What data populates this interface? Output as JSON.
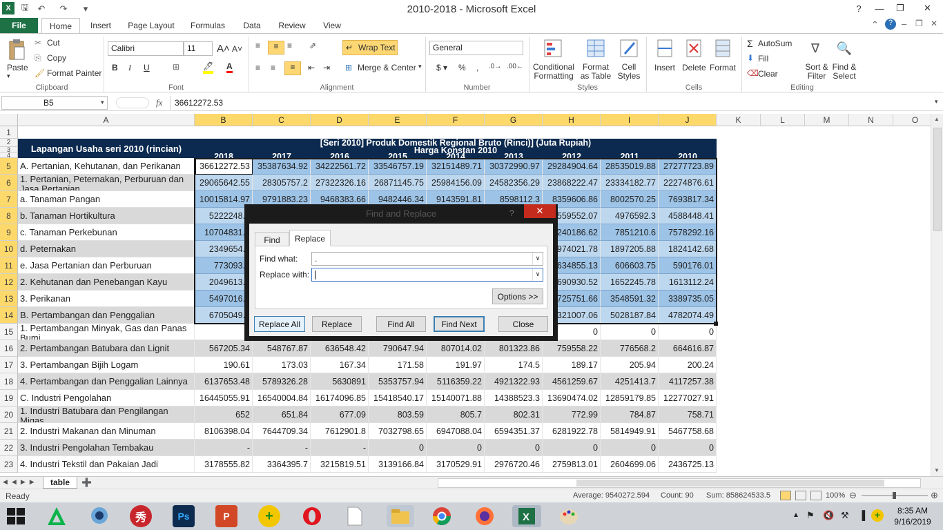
{
  "window": {
    "title": "2010-2018  -  Microsoft Excel"
  },
  "tabs": [
    "File",
    "Home",
    "Insert",
    "Page Layout",
    "Formulas",
    "Data",
    "Review",
    "View"
  ],
  "clipboard": {
    "paste": "Paste",
    "cut": "Cut",
    "copy": "Copy",
    "format_painter": "Format Painter",
    "group": "Clipboard"
  },
  "font": {
    "name": "Calibri",
    "size": "11",
    "group": "Font"
  },
  "alignment": {
    "wrap": "Wrap Text",
    "merge": "Merge & Center",
    "group": "Alignment"
  },
  "number": {
    "format": "General",
    "group": "Number"
  },
  "styles": {
    "conditional": "Conditional Formatting",
    "format_table": "Format as Table",
    "cell_styles": "Cell Styles",
    "group": "Styles"
  },
  "cells": {
    "insert": "Insert",
    "delete": "Delete",
    "format": "Format",
    "group": "Cells"
  },
  "editing": {
    "autosum": "AutoSum",
    "fill": "Fill",
    "clear": "Clear",
    "sort": "Sort & Filter",
    "find": "Find & Select",
    "group": "Editing"
  },
  "formula_bar": {
    "name_box": "B5",
    "fx": "fx",
    "value": "36612272.53"
  },
  "columns": [
    "A",
    "B",
    "C",
    "D",
    "E",
    "F",
    "G",
    "H",
    "I",
    "J",
    "K",
    "L",
    "M",
    "N",
    "O"
  ],
  "header": {
    "label": "Lapangan Usaha seri 2010 (rincian)",
    "title1": "[Seri 2010] Produk Domestik Regional Bruto (Rinci)] (Juta Rupiah)",
    "title2": "Harga Konstan 2010",
    "years": [
      "2018",
      "2017",
      "2016",
      "2015",
      "2014",
      "2013",
      "2012",
      "2011",
      "2010"
    ]
  },
  "rows": [
    {
      "n": "5",
      "label": "A. Pertanian, Kehutanan, dan Perikanan",
      "v": [
        "36612272.53",
        "35387634.92",
        "34222561.72",
        "33546757.19",
        "32151489.71",
        "30372990.97",
        "29284904.64",
        "28535019.88",
        "27277723.89"
      ]
    },
    {
      "n": "6",
      "label": "1. Pertanian, Peternakan, Perburuan dan Jasa Pertanian",
      "v": [
        "29065642.55",
        "28305757.2",
        "27322326.16",
        "26871145.75",
        "25984156.09",
        "24582356.29",
        "23868222.47",
        "23334182.77",
        "22274876.61"
      ]
    },
    {
      "n": "7",
      "label": "a. Tanaman Pangan",
      "v": [
        "10015814.97",
        "9791883.23",
        "9468383.66",
        "9482446.34",
        "9143591.81",
        "8598112.3",
        "8359606.86",
        "8002570.25",
        "7693817.34"
      ]
    },
    {
      "n": "8",
      "label": "b. Tanaman Hortikultura",
      "v": [
        "5222248.5",
        "",
        "",
        "",
        "",
        "",
        "5559552.07",
        "4976592.3",
        "4588448.41"
      ]
    },
    {
      "n": "9",
      "label": "c. Tanaman Perkebunan",
      "v": [
        "10704831.1",
        "",
        "",
        "",
        "",
        "",
        "8240186.62",
        "7851210.6",
        "7578292.16"
      ]
    },
    {
      "n": "10",
      "label": "d. Peternakan",
      "v": [
        "2349654.7",
        "",
        "",
        "",
        "",
        "",
        "1974021.78",
        "1897205.88",
        "1824142.68"
      ]
    },
    {
      "n": "11",
      "label": "e. Jasa Pertanian dan Perburuan",
      "v": [
        "773093.1",
        "",
        "",
        "",
        "",
        "",
        "634855.13",
        "606603.75",
        "590176.01"
      ]
    },
    {
      "n": "12",
      "label": "2. Kehutanan dan Penebangan Kayu",
      "v": [
        "2049613.7",
        "",
        "",
        "",
        "",
        "",
        "1690930.52",
        "1652245.78",
        "1613112.24"
      ]
    },
    {
      "n": "13",
      "label": "3. Perikanan",
      "v": [
        "5497016.2",
        "",
        "",
        "",
        "",
        "",
        "3725751.66",
        "3548591.32",
        "3389735.05"
      ]
    },
    {
      "n": "14",
      "label": "B. Pertambangan dan Penggalian",
      "v": [
        "6705049.4",
        "",
        "",
        "",
        "",
        "",
        "5321007.06",
        "5028187.84",
        "4782074.49"
      ]
    },
    {
      "n": "15",
      "label": "1. Pertambangan Minyak, Gas dan Panas Bumi",
      "v": [
        "",
        "",
        "",
        "",
        "",
        "",
        "0",
        "0",
        "0"
      ]
    },
    {
      "n": "16",
      "label": "2. Pertambangan Batubara dan Lignit",
      "v": [
        "567205.34",
        "548767.87",
        "636548.42",
        "790647.94",
        "807014.02",
        "801323.86",
        "759558.22",
        "776568.2",
        "664616.87"
      ]
    },
    {
      "n": "17",
      "label": "3. Pertambangan Bijih Logam",
      "v": [
        "190.61",
        "173.03",
        "167.34",
        "171.58",
        "191.97",
        "174.5",
        "189.17",
        "205.94",
        "200.24"
      ]
    },
    {
      "n": "18",
      "label": "4. Pertambangan dan Penggalian Lainnya",
      "v": [
        "6137653.48",
        "5789326.28",
        "5630891",
        "5353757.94",
        "5116359.22",
        "4921322.93",
        "4561259.67",
        "4251413.7",
        "4117257.38"
      ]
    },
    {
      "n": "19",
      "label": "C. Industri Pengolahan",
      "v": [
        "16445055.91",
        "16540004.84",
        "16174096.85",
        "15418540.17",
        "15140071.88",
        "14388523.3",
        "13690474.02",
        "12859179.85",
        "12277027.91"
      ]
    },
    {
      "n": "20",
      "label": "1. Industri Batubara dan Pengilangan Migas",
      "v": [
        "652",
        "651.84",
        "677.09",
        "803.59",
        "805.7",
        "802.31",
        "772.99",
        "784.87",
        "758.71"
      ]
    },
    {
      "n": "21",
      "label": "2. Industri Makanan dan Minuman",
      "v": [
        "8106398.04",
        "7644709.34",
        "7612901.8",
        "7032798.65",
        "6947088.04",
        "6594351.37",
        "6281922.78",
        "5814949.91",
        "5467758.68"
      ]
    },
    {
      "n": "22",
      "label": "3. Industri Pengolahan Tembakau",
      "v": [
        "-",
        "-",
        "-",
        "0",
        "0",
        "0",
        "0",
        "0",
        "0"
      ]
    },
    {
      "n": "23",
      "label": "4. Industri Tekstil dan Pakaian Jadi",
      "v": [
        "3178555.82",
        "3364395.7",
        "3215819.51",
        "3139166.84",
        "3170529.91",
        "2976720.46",
        "2759813.01",
        "2604699.06",
        "2436725.13"
      ]
    }
  ],
  "sheet_tab": "table",
  "status": {
    "ready": "Ready",
    "average": "Average: 9540272.594",
    "count": "Count: 90",
    "sum": "Sum: 858624533.5",
    "zoom": "100%"
  },
  "dialog": {
    "title": "Find and Replace",
    "tab_find": "Find",
    "tab_replace": "Replace",
    "find_label": "Find what:",
    "find_value": ".",
    "replace_label": "Replace with:",
    "replace_value": "",
    "options": "Options >>",
    "replace_all": "Replace All",
    "replace": "Replace",
    "find_all": "Find All",
    "find_next": "Find Next",
    "close": "Close",
    "help": "?"
  },
  "taskbar": {
    "time": "8:35 AM",
    "date": "9/16/2019"
  }
}
